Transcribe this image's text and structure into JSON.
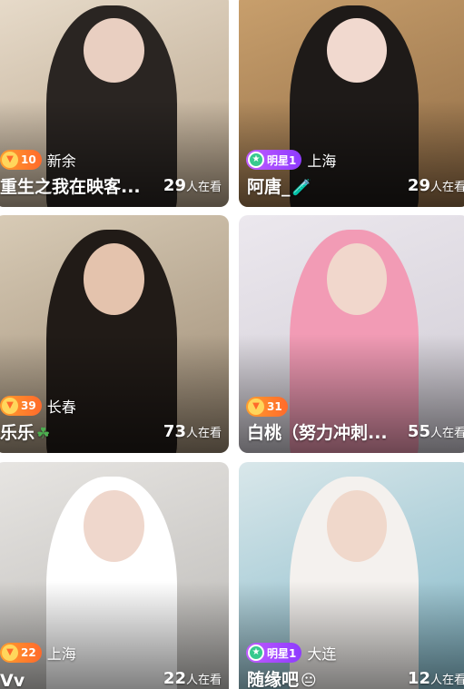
{
  "streams": [
    {
      "level": "10",
      "badge_type": "level",
      "city": "新余",
      "name": "重生之我在映客...",
      "emoji": "",
      "viewers": "29",
      "viewers_unit": "人在看",
      "colors": {
        "bg": "#b6a38a",
        "bg2": "#e8dccb",
        "figure": "#2a2522",
        "head": "#e9cfc1"
      }
    },
    {
      "level": "明星1",
      "badge_type": "star",
      "city": "上海",
      "name": "阿唐_",
      "emoji": "🧪",
      "viewers": "29",
      "viewers_unit": "人在看",
      "colors": {
        "bg": "#8f6b45",
        "bg2": "#c9a06d",
        "figure": "#1e1a18",
        "head": "#f1d9cf"
      }
    },
    {
      "level": "39",
      "badge_type": "level",
      "city": "长春",
      "name": "乐乐",
      "emoji": "☘",
      "viewers": "73",
      "viewers_unit": "人在看",
      "colors": {
        "bg": "#9c8a73",
        "bg2": "#d8cbb6",
        "figure": "#211b17",
        "head": "#e4c3ad"
      }
    },
    {
      "level": "31",
      "badge_type": "level",
      "city": "",
      "name": "白桃（努力冲刺...",
      "emoji": "",
      "viewers": "55",
      "viewers_unit": "人在看",
      "colors": {
        "bg": "#cfcbd4",
        "bg2": "#ece8ee",
        "figure": "#f29bb5",
        "head": "#f1d7cc"
      }
    },
    {
      "level": "22",
      "badge_type": "level",
      "city": "上海",
      "name": "Vv",
      "emoji": "",
      "viewers": "22",
      "viewers_unit": "人在看",
      "colors": {
        "bg": "#b9b7b4",
        "bg2": "#e7e5e2",
        "figure": "#ffffff",
        "head": "#efd7cc"
      }
    },
    {
      "level": "明星1",
      "badge_type": "star",
      "city": "大连",
      "name": "随缘吧",
      "emoji": "😐",
      "viewers": "12",
      "viewers_unit": "人在看",
      "colors": {
        "bg": "#7fb6c7",
        "bg2": "#d9e7ea",
        "figure": "#f4f1ee",
        "head": "#f0d8cb"
      }
    }
  ]
}
